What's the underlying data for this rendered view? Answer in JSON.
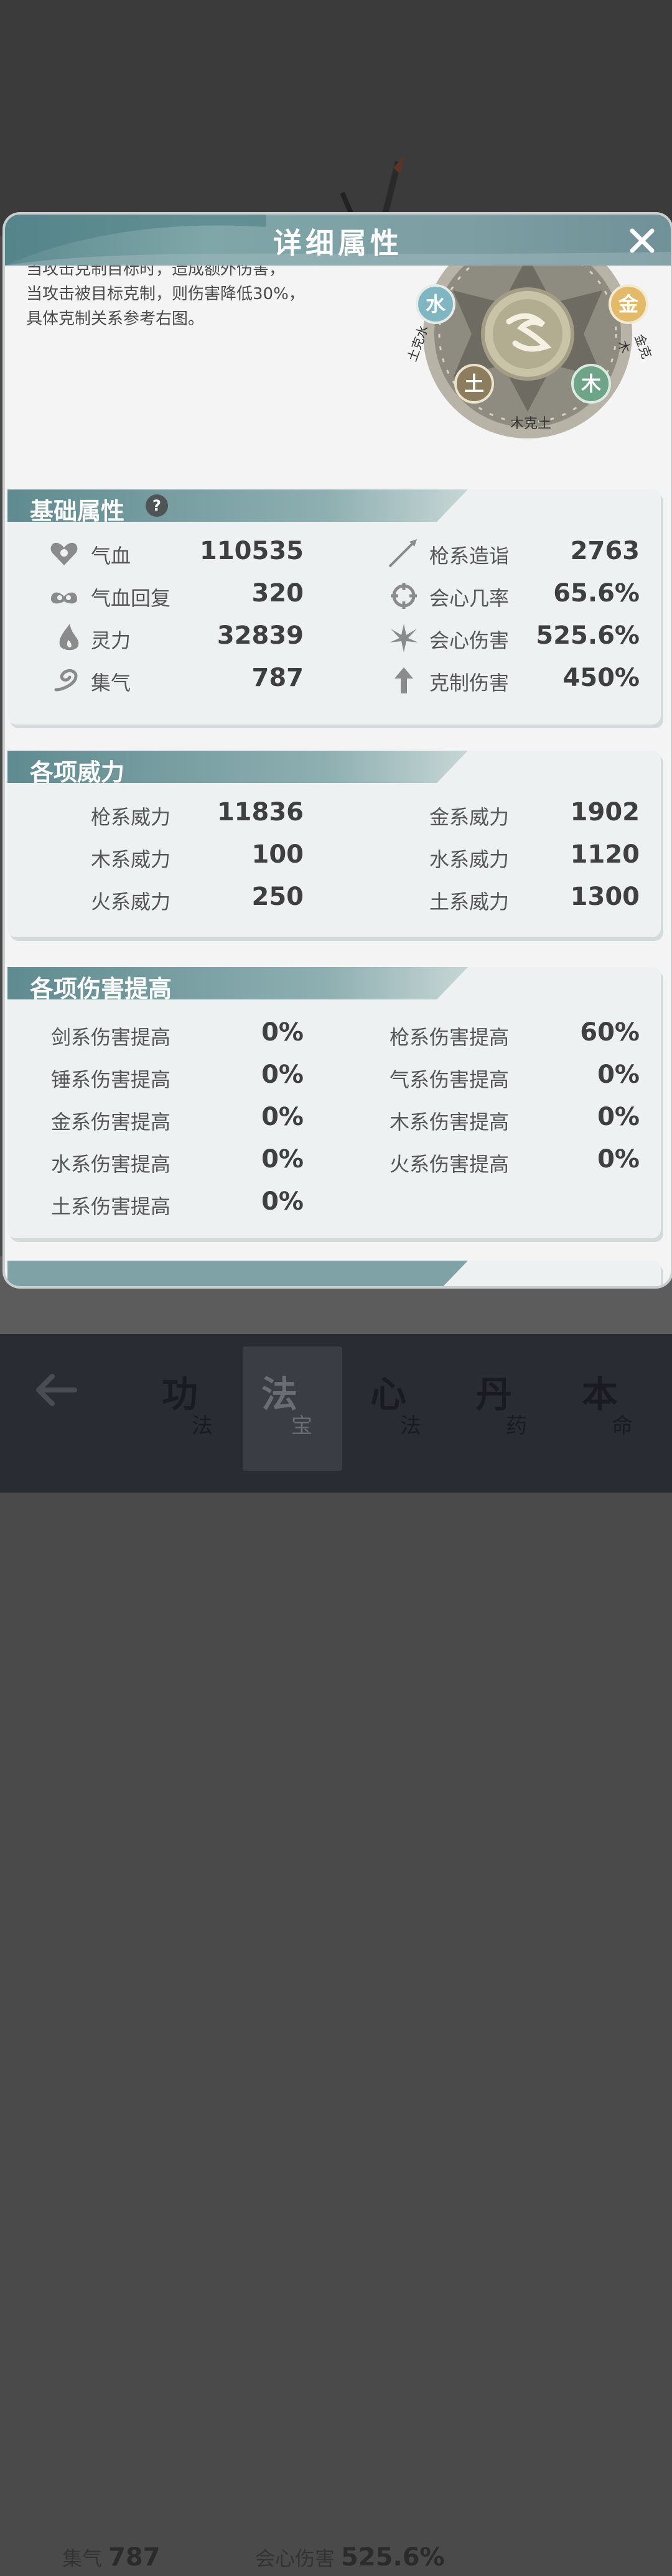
{
  "modal": {
    "title": "详细属性",
    "description": [
      "当攻击克制目标时，造成额外伤害，",
      "当攻击被目标克制，则伤害降低30%，",
      "具体克制关系参考右图。"
    ],
    "wheel": {
      "elements": [
        "水",
        "金",
        "土",
        "木"
      ],
      "labels": [
        "土克水",
        "金克木",
        "木克土"
      ]
    }
  },
  "basic": {
    "title": "基础属性",
    "help": "?",
    "left": [
      {
        "label": "气血",
        "value": "110535",
        "icon": "heart-icon"
      },
      {
        "label": "气血回复",
        "value": "320",
        "icon": "heal-icon"
      },
      {
        "label": "灵力",
        "value": "32839",
        "icon": "flame-icon"
      },
      {
        "label": "集气",
        "value": "787",
        "icon": "swirl-icon"
      }
    ],
    "right": [
      {
        "label": "枪系造诣",
        "value": "2763",
        "icon": "spear-icon"
      },
      {
        "label": "会心几率",
        "value": "65.6%",
        "icon": "crit-rate-icon"
      },
      {
        "label": "会心伤害",
        "value": "525.6%",
        "icon": "burst-icon"
      },
      {
        "label": "克制伤害",
        "value": "450%",
        "icon": "arrow-up-icon"
      }
    ]
  },
  "power": {
    "title": "各项威力",
    "left": [
      {
        "label": "枪系威力",
        "value": "11836"
      },
      {
        "label": "木系威力",
        "value": "100"
      },
      {
        "label": "火系威力",
        "value": "250"
      }
    ],
    "right": [
      {
        "label": "金系威力",
        "value": "1902"
      },
      {
        "label": "水系威力",
        "value": "1120"
      },
      {
        "label": "土系威力",
        "value": "1300"
      }
    ]
  },
  "damage": {
    "title": "各项伤害提高",
    "left": [
      {
        "label": "剑系伤害提高",
        "value": "0%"
      },
      {
        "label": "锤系伤害提高",
        "value": "0%"
      },
      {
        "label": "金系伤害提高",
        "value": "0%"
      },
      {
        "label": "水系伤害提高",
        "value": "0%"
      },
      {
        "label": "土系伤害提高",
        "value": "0%"
      }
    ],
    "right": [
      {
        "label": "枪系伤害提高",
        "value": "60%"
      },
      {
        "label": "气系伤害提高",
        "value": "0%"
      },
      {
        "label": "木系伤害提高",
        "value": "0%"
      },
      {
        "label": "火系伤害提高",
        "value": "0%"
      }
    ]
  },
  "background": {
    "stat1_label": "集气",
    "stat1_value": "787",
    "stat2_label": "会心伤害",
    "stat2_value": "525.6%"
  },
  "nav": {
    "items": [
      {
        "big": "功",
        "small": "法"
      },
      {
        "big": "法",
        "small": "宝"
      },
      {
        "big": "心",
        "small": "法"
      },
      {
        "big": "丹",
        "small": "药"
      },
      {
        "big": "本",
        "small": "命"
      }
    ]
  }
}
